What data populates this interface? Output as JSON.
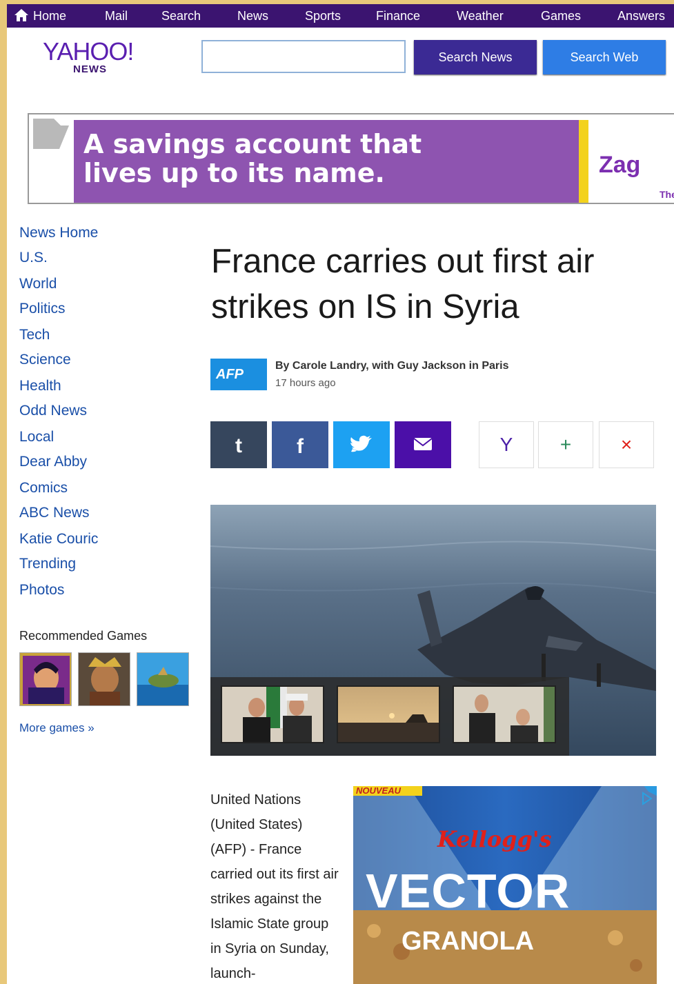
{
  "nav": {
    "items": [
      "Home",
      "Mail",
      "Search",
      "News",
      "Sports",
      "Finance",
      "Weather",
      "Games",
      "Answers"
    ]
  },
  "header": {
    "logo_text": "YAHOO!",
    "logo_sub": "NEWS",
    "search_value": "",
    "search_news_label": "Search News",
    "search_web_label": "Search Web"
  },
  "ad_banner": {
    "headline": "A savings account that lives up to its name.",
    "brand": "Zag",
    "tag": "The"
  },
  "sidebar": {
    "links": [
      "News Home",
      "U.S.",
      "World",
      "Politics",
      "Tech",
      "Science",
      "Health",
      "Odd News",
      "Local",
      "Dear Abby",
      "Comics",
      "ABC News",
      "Katie Couric",
      "Trending",
      "Photos"
    ],
    "games_title": "Recommended Games",
    "more_games": "More games »"
  },
  "article": {
    "headline": "France carries out first air strikes on IS in Syria",
    "source_logo": "AFP",
    "byline": "By Carole Landry, with Guy Jackson in Paris",
    "timestamp": "17 hours ago",
    "body": "United Nations (United States) (AFP) - France carried out its first air strikes against the Islamic State group in Syria on Sunday, launch-"
  },
  "share": {
    "buttons": [
      "tumblr",
      "facebook",
      "twitter",
      "email"
    ],
    "tools": [
      "Y",
      "+",
      "×"
    ]
  },
  "ad_cereal": {
    "badge": "NOUVEAU",
    "brand": "Kellogg's",
    "product": "VECTOR",
    "subtitle": "GRANOLA"
  },
  "colors": {
    "nav_bg": "#3b1470",
    "link": "#1a4fa8",
    "search_news_btn": "#3b2a94",
    "search_web_btn": "#2e7de5",
    "ad_purple": "#8e54b0",
    "tumblr": "#36465d",
    "facebook": "#3b5998",
    "twitter": "#1da1f2",
    "email": "#4b0fa8"
  }
}
